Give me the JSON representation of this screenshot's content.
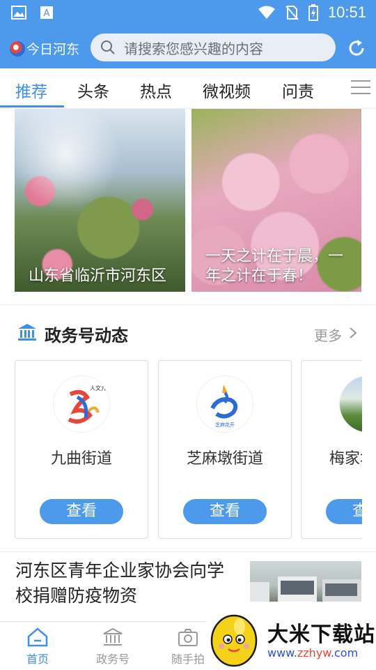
{
  "status_bar": {
    "time": "10:51"
  },
  "header": {
    "logo_text": "今日河东",
    "search_placeholder": "请搜索您感兴趣的内容"
  },
  "tabs": [
    {
      "label": "推荐",
      "active": true
    },
    {
      "label": "头条"
    },
    {
      "label": "热点"
    },
    {
      "label": "微视频"
    },
    {
      "label": "问责"
    }
  ],
  "photos": [
    {
      "caption": "山东省临沂市河东区"
    },
    {
      "caption": "一天之计在于晨，一年之计在于春！"
    }
  ],
  "section": {
    "title": "政务号动态",
    "more": "更多"
  },
  "accounts": [
    {
      "name": "九曲街道",
      "button": "查看"
    },
    {
      "name": "芝麻墩街道",
      "button": "查看"
    },
    {
      "name": "梅家埠街道",
      "button": "查看"
    }
  ],
  "news": {
    "title": "河东区青年企业家协会向学校捐赠防疫物资"
  },
  "bottom_nav": [
    {
      "label": "首页",
      "icon": "home-icon",
      "active": true
    },
    {
      "label": "政务号",
      "icon": "government-icon"
    },
    {
      "label": "随手拍",
      "icon": "camera-icon"
    }
  ],
  "watermark": {
    "title": "大米下载站",
    "url_prefix": "www.",
    "url_brand": "zzhyw",
    "url_suffix": ".com"
  },
  "colors": {
    "primary": "#4d99eb",
    "active_tab": "#3f8fe6"
  }
}
